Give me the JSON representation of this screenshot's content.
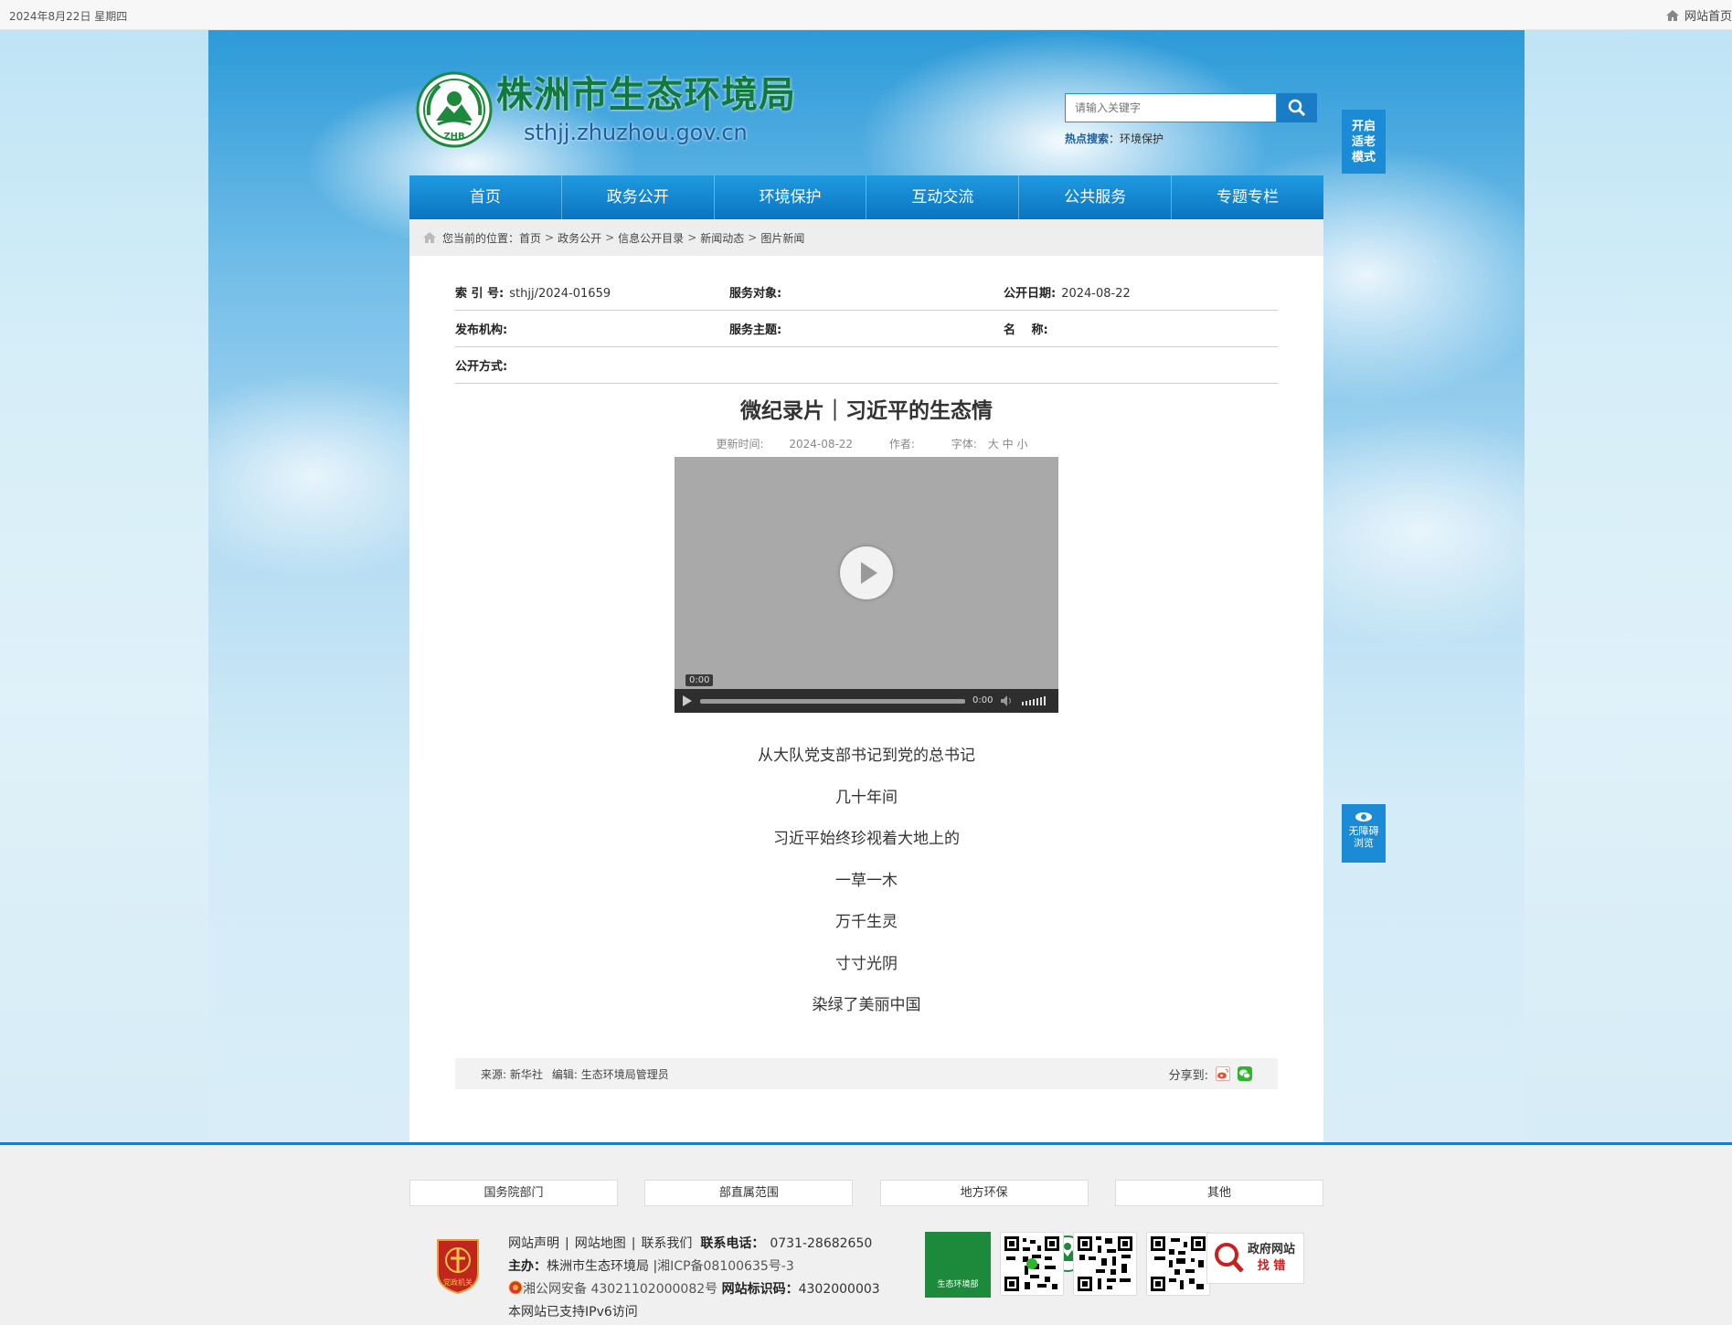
{
  "topbar": {
    "date": "2024年8月22日 星期四",
    "home_link": "网站首页"
  },
  "header": {
    "title": "株洲市生态环境局",
    "url": "sthjj.zhuzhou.gov.cn",
    "emblem_text": "ZHB"
  },
  "search": {
    "placeholder": "请输入关键字",
    "hot_label": "热点搜索",
    "hot_colon": "：",
    "hot_term": "环境保护"
  },
  "elder_mode": {
    "line1": "开启",
    "line2": "适老",
    "line3": "模式"
  },
  "nav": {
    "items": [
      "首页",
      "政务公开",
      "环境保护",
      "互动交流",
      "公共服务",
      "专题专栏"
    ]
  },
  "breadcrumb": {
    "label": "您当前的位置：",
    "items": [
      "首页",
      "政务公开",
      "信息公开目录",
      "新闻动态",
      "图片新闻"
    ],
    "sep": ">"
  },
  "meta": {
    "index_label": "索 引 号:",
    "index_value": "sthjj/2024-01659",
    "service_target_label": "服务对象:",
    "service_target_value": "",
    "publish_date_label": "公开日期:",
    "publish_date_value": "2024-08-22",
    "org_label": "发布机构:",
    "org_value": "",
    "topic_label": "服务主题:",
    "topic_value": "",
    "name_label": "名　 称:",
    "name_value": "",
    "method_label": "公开方式:",
    "method_value": ""
  },
  "article": {
    "title": "微纪录片｜习近平的生态情",
    "update_label": "更新时间:",
    "update_value": "2024-08-22",
    "author_label": "作者:",
    "font_label": "字体:",
    "font_large": "大",
    "font_medium": "中",
    "font_small": "小",
    "paragraphs": [
      "从大队党支部书记到党的总书记",
      "几十年间",
      "习近平始终珍视着大地上的",
      "一草一木",
      "万千生灵",
      "寸寸光阴",
      "染绿了美丽中国"
    ]
  },
  "video": {
    "time_bubble": "0:00",
    "time_label": "0:00",
    "progress": 0
  },
  "article_footer": {
    "source_label": "来源:",
    "source_value": "新华社",
    "editor_label": "编辑:",
    "editor_value": "生态环境局管理员",
    "share_label": "分享到:"
  },
  "accessibility": {
    "line1": "无障碍",
    "line2": "浏览"
  },
  "footer": {
    "link_boxes": [
      "国务院部门",
      "部直属范围",
      "地方环保",
      "其他"
    ],
    "links": [
      "网站声明",
      "网站地图",
      "联系我们"
    ],
    "phone_label": "联系电话：",
    "phone_value": "0731-28682650",
    "host_label": "主办：",
    "host_value": "株洲市生态环境局",
    "icp": "湘ICP备08100635号-3",
    "police": "湘公网安备 43021102000082号",
    "site_id_label": "网站标识码：",
    "site_id_value": "4302000003",
    "ipv6": "本网站已支持IPv6访问",
    "badge_text": "党政机关",
    "qr_logo_text": "生态环境部",
    "gov_error_line1": "政府网站",
    "gov_error_line2": "找 错"
  },
  "colors": {
    "nav_blue": "#1486d1",
    "brand_green": "#0f7a3c",
    "link_blue": "#1a5f9f"
  }
}
